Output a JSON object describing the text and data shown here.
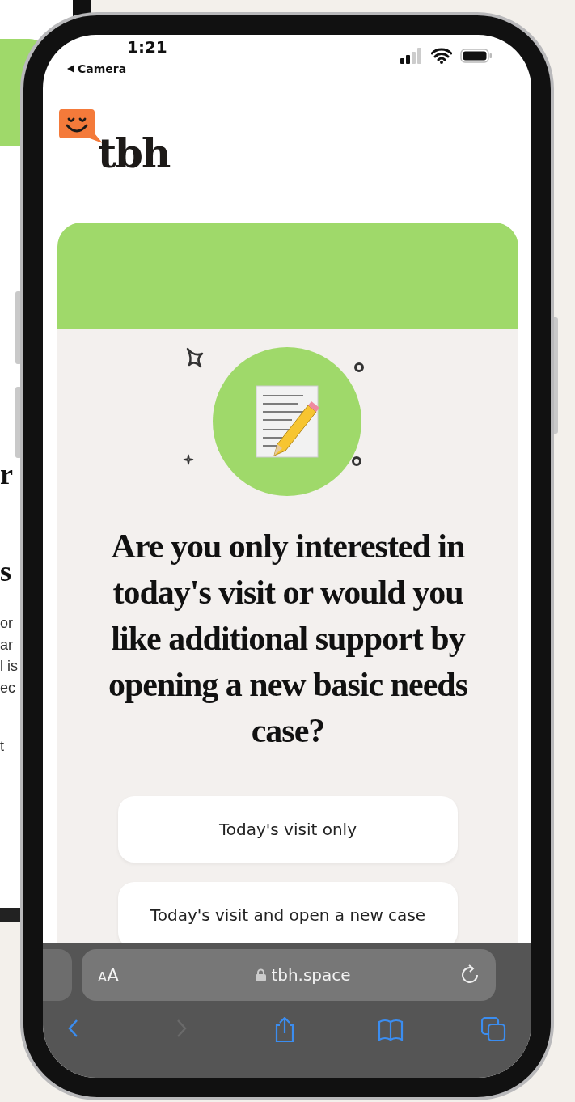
{
  "background_page": {
    "texts": [
      {
        "kind": "heading",
        "text": "r"
      },
      {
        "kind": "heading",
        "text": "s"
      },
      {
        "kind": "body",
        "text": "or"
      },
      {
        "kind": "body",
        "text": "ar"
      },
      {
        "kind": "body",
        "text": "l is"
      },
      {
        "kind": "body",
        "text": "ec"
      },
      {
        "kind": "body",
        "text": "t"
      }
    ]
  },
  "status_bar": {
    "time": "1:21",
    "back_app": "Camera"
  },
  "brand": {
    "name": "tbh"
  },
  "question": "Are you only interested in today's visit or would you like additional support by opening a new basic needs case?",
  "options": [
    {
      "label": "Today's visit only"
    },
    {
      "label": "Today's visit and open a new case"
    }
  ],
  "browser": {
    "text_size": "AA",
    "url": "tbh.space",
    "nav": [
      {
        "kind": "back",
        "disabled": false
      },
      {
        "kind": "forward",
        "disabled": true
      },
      {
        "kind": "share",
        "disabled": false
      },
      {
        "kind": "bookmarks",
        "disabled": false
      },
      {
        "kind": "tabs",
        "disabled": false
      }
    ]
  }
}
